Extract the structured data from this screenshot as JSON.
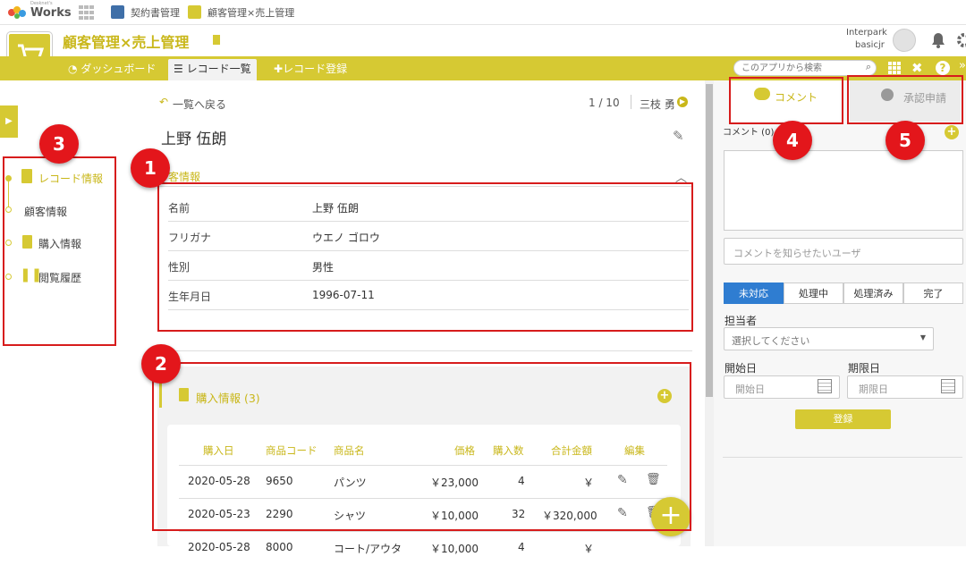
{
  "topbar": {
    "brand": "Works",
    "brand_small": "Desknet's",
    "crumb1": "契約書管理",
    "crumb2": "顧客管理×売上管理"
  },
  "app": {
    "title": "顧客管理×売上管理",
    "user_line1": "Interpark",
    "user_line2": "basicjr"
  },
  "nav": {
    "dashboard": "ダッシュボード",
    "records": "レコード一覧",
    "register": "レコード登録",
    "search_placeholder": "このアプリから検索"
  },
  "left": {
    "record_info": "レコード情報",
    "customer_info": "顧客情報",
    "purchase_info": "購入情報",
    "view_history": "閲覧履歴"
  },
  "record": {
    "back": "一覧へ戻る",
    "pager": "1 / 10",
    "owner": "三枝 勇",
    "name": "上野 伍朗",
    "section_title": "客情報",
    "fields": [
      {
        "k": "名前",
        "v": "上野 伍朗"
      },
      {
        "k": "フリガナ",
        "v": "ウエノ ゴロウ"
      },
      {
        "k": "性別",
        "v": "男性"
      },
      {
        "k": "生年月日",
        "v": "1996-07-11"
      }
    ]
  },
  "purchase": {
    "title": "購入情報 (3)",
    "headers": [
      "購入日",
      "商品コード",
      "商品名",
      "価格",
      "購入数",
      "合計金額",
      "編集"
    ],
    "rows": [
      {
        "date": "2020-05-28",
        "code": "9650",
        "name": "パンツ",
        "price": "￥23,000",
        "qty": "4",
        "total": "￥"
      },
      {
        "date": "2020-05-23",
        "code": "2290",
        "name": "シャツ",
        "price": "￥10,000",
        "qty": "32",
        "total": "￥320,000"
      },
      {
        "date": "2020-05-28",
        "code": "8000",
        "name": "コート/アウタ",
        "price": "￥10,000",
        "qty": "4",
        "total": "￥"
      }
    ]
  },
  "side": {
    "tab_comment": "コメント",
    "tab_approval": "承認申請",
    "comment_count": "コメント (0)",
    "notify_placeholder": "コメントを知らせたいユーザ",
    "status": [
      "未対応",
      "処理中",
      "処理済み",
      "完了"
    ],
    "assignee_label": "担当者",
    "assignee_placeholder": "選択してください",
    "start_label": "開始日",
    "due_label": "期限日",
    "start_placeholder": "開始日",
    "due_placeholder": "期限日",
    "submit": "登録"
  },
  "badges": [
    "1",
    "2",
    "3",
    "4",
    "5"
  ],
  "colors": {
    "accent": "#d6c933",
    "active_status": "#2f7dd1",
    "annotation": "#e3161b"
  }
}
